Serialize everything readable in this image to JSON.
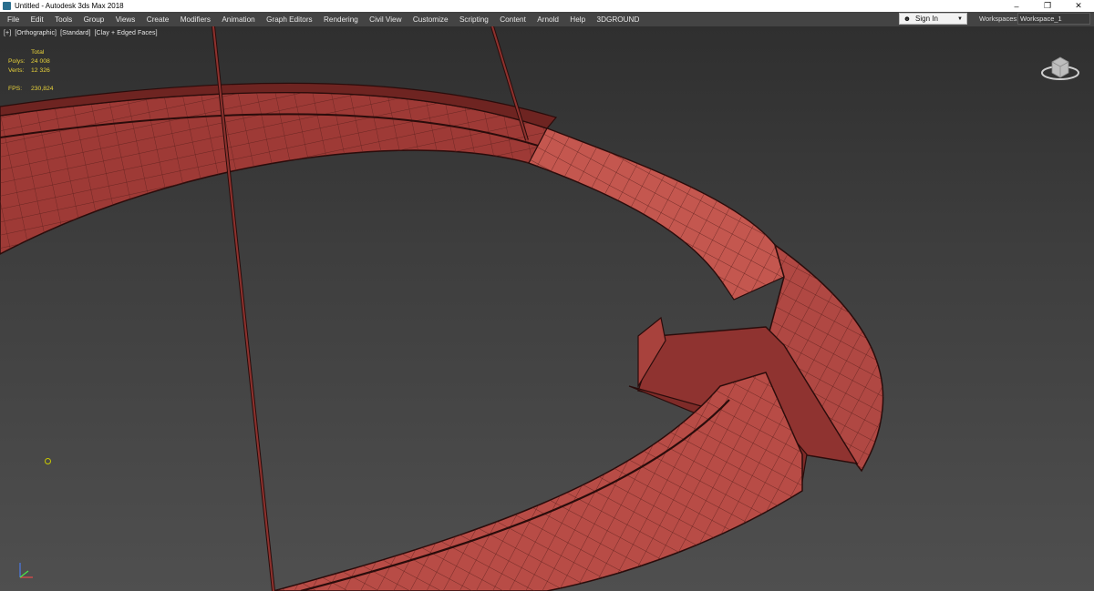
{
  "titlebar": {
    "title": "Untitled - Autodesk 3ds Max 2018",
    "minimize_glyph": "–",
    "restore_glyph": "❐",
    "close_glyph": "✕"
  },
  "menu": [
    "File",
    "Edit",
    "Tools",
    "Group",
    "Views",
    "Create",
    "Modifiers",
    "Animation",
    "Graph Editors",
    "Rendering",
    "Civil View",
    "Customize",
    "Scripting",
    "Content",
    "Arnold",
    "Help",
    "3DGROUND"
  ],
  "account": {
    "signin_label": "Sign In"
  },
  "workspace": {
    "label": "Workspaces:",
    "value": "Workspace_1"
  },
  "viewport": {
    "labels": [
      "[+]",
      "[Orthographic]",
      "[Standard]",
      "[Clay + Edged Faces]"
    ],
    "stats": {
      "header": "Total",
      "polys_label": "Polys:",
      "polys_value": "24 008",
      "verts_label": "Verts:",
      "verts_value": "12 326",
      "fps_label": "FPS:",
      "fps_value": "230,824"
    }
  },
  "colors": {
    "clay": "#b24a45",
    "edge": "#2a0c0b",
    "stats_text": "#e8d23a"
  }
}
